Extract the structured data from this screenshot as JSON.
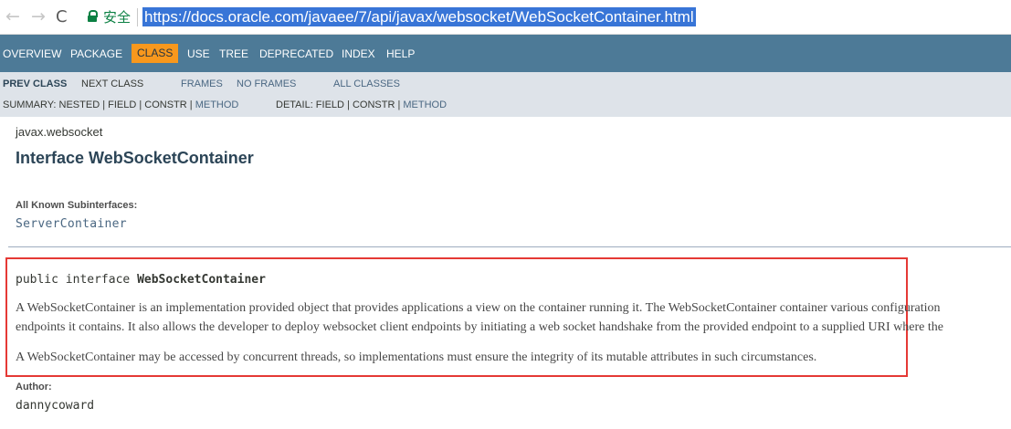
{
  "browser": {
    "back_icon": "←",
    "forward_icon": "→",
    "reload_icon": "C",
    "secure_label": "安全",
    "url": "https://docs.oracle.com/javaee/7/api/javax/websocket/WebSocketContainer.html"
  },
  "topnav": {
    "items": [
      "OVERVIEW",
      "PACKAGE",
      "CLASS",
      "USE",
      "TREE",
      "DEPRECATED",
      "INDEX",
      "HELP"
    ],
    "active": "CLASS",
    "active_color": "#f8981d",
    "background": "#4d7a97"
  },
  "subnav": {
    "prev_class": "PREV CLASS",
    "next_class": "NEXT CLASS",
    "frames": "FRAMES",
    "no_frames": "NO FRAMES",
    "all_classes": "ALL CLASSES",
    "summary_prefix": "SUMMARY: NESTED | FIELD | CONSTR | ",
    "summary_method": "METHOD",
    "detail_prefix": "DETAIL: FIELD | CONSTR | ",
    "detail_method": "METHOD"
  },
  "content": {
    "package": "javax.websocket",
    "title": "Interface WebSocketContainer",
    "subinterfaces_label": "All Known Subinterfaces:",
    "subinterfaces": [
      "ServerContainer"
    ],
    "declaration_prefix": "public interface ",
    "declaration_name": "WebSocketContainer",
    "description_lines": [
      "A WebSocketContainer is an implementation provided object that provides applications a view on the container running it. The WebSocketContainer container various configuration",
      "endpoints it contains. It also allows the developer to deploy websocket client endpoints by initiating a web socket handshake from the provided endpoint to a supplied URI where the",
      "A WebSocketContainer may be accessed by concurrent threads, so implementations must ensure the integrity of its mutable attributes in such circumstances."
    ],
    "author_label": "Author:",
    "author": "dannycoward"
  },
  "highlight_color": "#e53935"
}
